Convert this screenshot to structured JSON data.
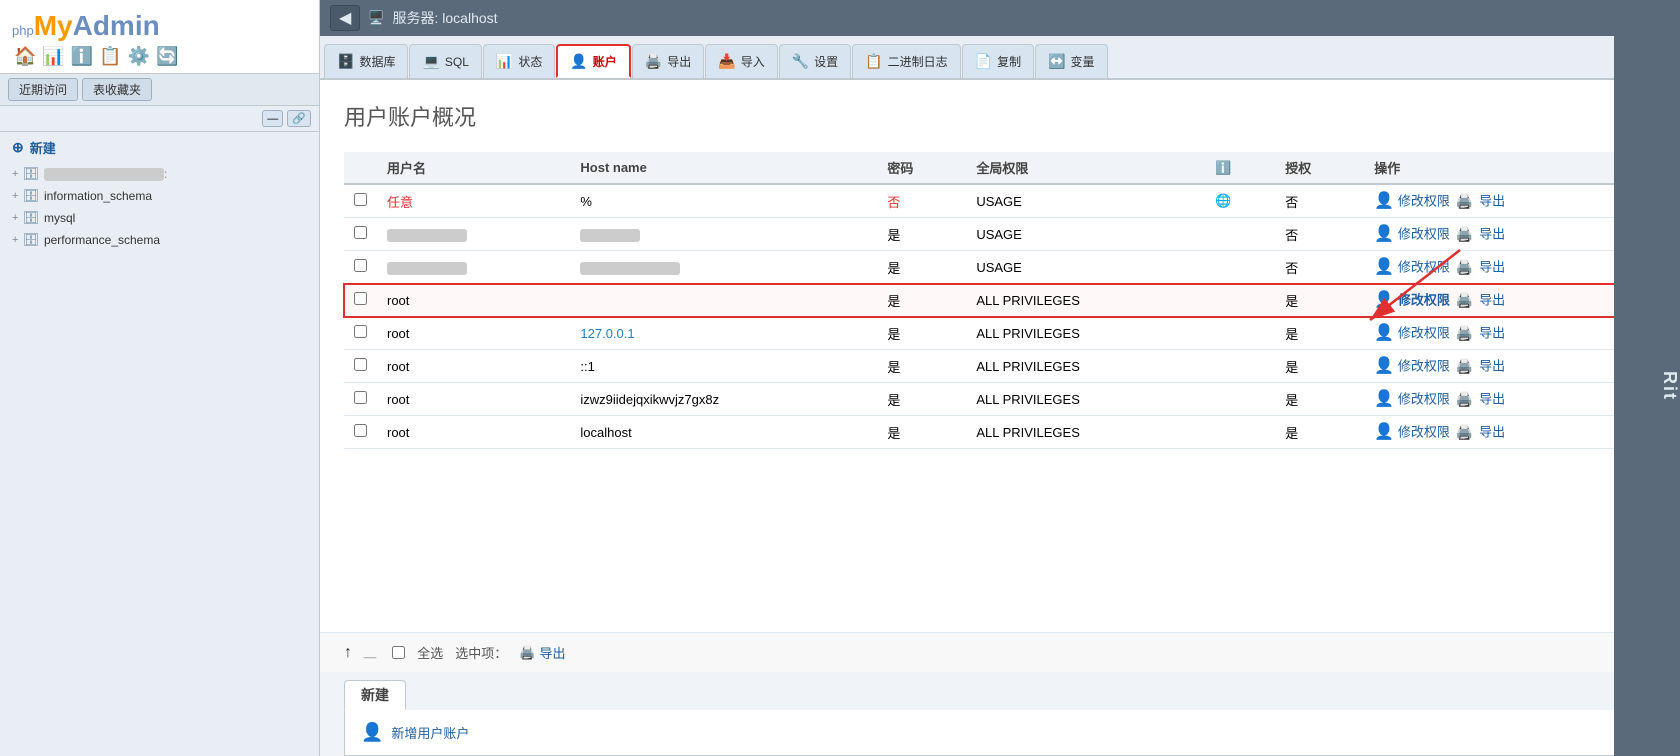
{
  "logo": {
    "php": "php",
    "my": "My",
    "admin": "Admin"
  },
  "logo_icons": [
    "🏠",
    "📊",
    "ℹ️",
    "📋",
    "⚙️",
    "🔄"
  ],
  "sidebar": {
    "nav": [
      "近期访问",
      "表收藏夹"
    ],
    "new_label": "新建",
    "databases": [
      {
        "name": "blurred1",
        "blurred": true
      },
      {
        "name": "information_schema",
        "blurred": false
      },
      {
        "name": "mysql",
        "blurred": false
      },
      {
        "name": "performance_schema",
        "blurred": false
      }
    ]
  },
  "server": {
    "title": "服务器: localhost",
    "back_icon": "◀"
  },
  "tabs": [
    {
      "id": "database",
      "icon": "🗄️",
      "label": "数据库",
      "active": false
    },
    {
      "id": "sql",
      "icon": "💻",
      "label": "SQL",
      "active": false
    },
    {
      "id": "status",
      "icon": "📊",
      "label": "状态",
      "active": false
    },
    {
      "id": "accounts",
      "icon": "👤",
      "label": "账户",
      "active": true
    },
    {
      "id": "export",
      "icon": "🖨️",
      "label": "导出",
      "active": false
    },
    {
      "id": "import",
      "icon": "📥",
      "label": "导入",
      "active": false
    },
    {
      "id": "settings",
      "icon": "🔧",
      "label": "设置",
      "active": false
    },
    {
      "id": "binary-log",
      "icon": "📋",
      "label": "二进制日志",
      "active": false
    },
    {
      "id": "replicate",
      "icon": "📄",
      "label": "复制",
      "active": false
    },
    {
      "id": "variables",
      "icon": "↔️",
      "label": "变量",
      "active": false
    }
  ],
  "page": {
    "title": "用户账户概况"
  },
  "table": {
    "headers": [
      "",
      "用户名",
      "Host name",
      "密码",
      "全局权限",
      "",
      "授权",
      "操作"
    ],
    "rows": [
      {
        "id": "row-1",
        "username": "任意",
        "username_class": "red",
        "host": "%",
        "password": "否",
        "password_class": "red",
        "privileges": "USAGE",
        "grant": "否",
        "highlight": false,
        "actions": [
          "修改权限",
          "导出"
        ]
      },
      {
        "id": "row-2",
        "username": "blurred_2",
        "username_class": "blurred",
        "host": "blurred_host",
        "host_class": "blurred",
        "password": "是",
        "privileges": "USAGE",
        "grant": "否",
        "highlight": false,
        "actions": [
          "修改权限",
          "导出"
        ]
      },
      {
        "id": "row-3",
        "username": "blurred_3",
        "username_class": "blurred",
        "host": "blurred_host_3",
        "host_class": "blurred",
        "password": "是",
        "privileges": "USAGE",
        "grant": "否",
        "highlight": false,
        "actions": [
          "修改权限",
          "导出"
        ]
      },
      {
        "id": "row-4",
        "username": "root",
        "host": "",
        "password": "是",
        "privileges": "ALL PRIVILEGES",
        "grant": "是",
        "highlight": true,
        "actions": [
          "修改权限",
          "导出"
        ]
      },
      {
        "id": "row-5",
        "username": "root",
        "host": "127.0.0.1",
        "host_class": "blue",
        "password": "是",
        "privileges": "ALL PRIVILEGES",
        "grant": "是",
        "highlight": false,
        "actions": [
          "修改权限",
          "导出"
        ]
      },
      {
        "id": "row-6",
        "username": "root",
        "host": "::1",
        "password": "是",
        "privileges": "ALL PRIVILEGES",
        "grant": "是",
        "highlight": false,
        "actions": [
          "修改权限",
          "导出"
        ]
      },
      {
        "id": "row-7",
        "username": "root",
        "host": "izwz9iidejqxikwvjz7gx8z",
        "password": "是",
        "privileges": "ALL PRIVILEGES",
        "grant": "是",
        "highlight": false,
        "actions": [
          "修改权限",
          "导出"
        ]
      },
      {
        "id": "row-8",
        "username": "root",
        "host": "localhost",
        "password": "是",
        "privileges": "ALL PRIVILEGES",
        "grant": "是",
        "highlight": false,
        "actions": [
          "修改权限",
          "导出"
        ]
      }
    ]
  },
  "bottom": {
    "select_all": "全选",
    "selected_label": "选中项：",
    "export_label": "导出"
  },
  "new_section": {
    "tab_label": "新建",
    "add_user_label": "新增用户账户"
  },
  "watermark": "Rit"
}
